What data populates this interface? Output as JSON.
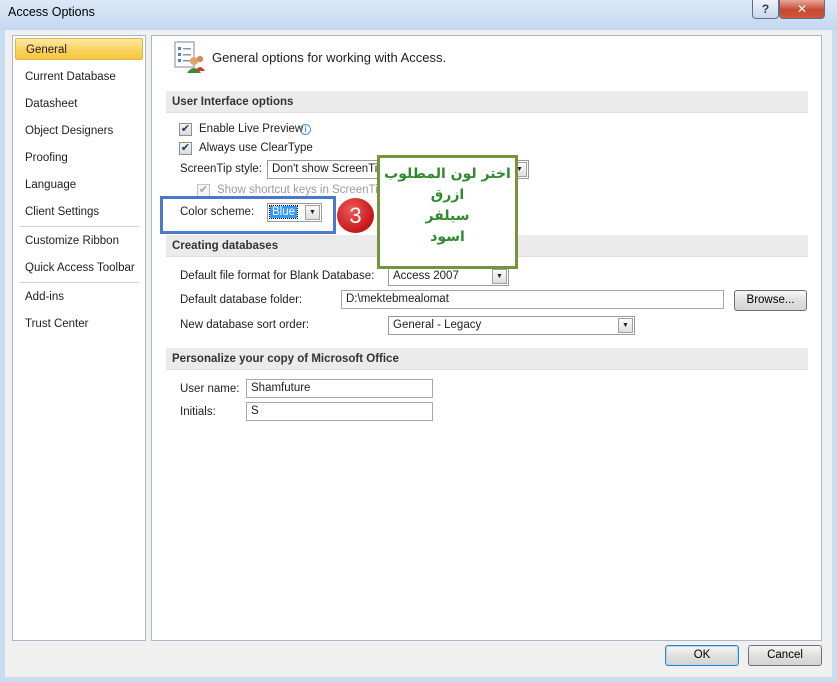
{
  "window": {
    "title": "Access Options",
    "help_label": "?",
    "close_label": "✕"
  },
  "nav": {
    "items": [
      {
        "label": "General",
        "selected": true
      },
      {
        "label": "Current Database"
      },
      {
        "label": "Datasheet"
      },
      {
        "label": "Object Designers"
      },
      {
        "label": "Proofing"
      },
      {
        "label": "Language"
      },
      {
        "label": "Client Settings"
      },
      {
        "label": "Customize Ribbon"
      },
      {
        "label": "Quick Access Toolbar"
      },
      {
        "label": "Add-ins"
      },
      {
        "label": "Trust Center"
      }
    ]
  },
  "header": {
    "text": "General options for working with Access."
  },
  "ui_options": {
    "title": "User Interface options",
    "live_preview": {
      "label": "Enable Live Preview",
      "checked": true
    },
    "cleartype": {
      "label": "Always use ClearType",
      "checked": true
    },
    "screentip": {
      "label": "ScreenTip style:",
      "value": "Don't show ScreenTips"
    },
    "shortcut_keys": {
      "label": "Show shortcut keys in ScreenTips",
      "checked": true,
      "enabled": false
    },
    "color_scheme": {
      "label": "Color scheme:",
      "value": "Blue"
    }
  },
  "creating": {
    "title": "Creating databases",
    "file_format": {
      "label": "Default file format for Blank Database:",
      "value": "Access 2007"
    },
    "folder": {
      "label": "Default database folder:",
      "value": "D:\\mektebmealomat",
      "browse_label": "Browse..."
    },
    "sort_order": {
      "label": "New database sort order:",
      "value": "General - Legacy"
    }
  },
  "personalize": {
    "title": "Personalize your copy of Microsoft Office",
    "user_name": {
      "label": "User name:",
      "value": "Shamfuture"
    },
    "initials": {
      "label": "Initials:",
      "value": "S"
    }
  },
  "annotation": {
    "step": "3",
    "lines": [
      "اختر لون المطلوب",
      "ازرق",
      "سيلفر",
      "اسود"
    ]
  },
  "footer": {
    "ok_label": "OK",
    "cancel_label": "Cancel"
  },
  "colors": {
    "accent_selected": "#fbd25e",
    "highlight_border": "#4a79c9",
    "callout_border": "#77933c",
    "callout_text": "#2d8a2d",
    "badge": "#d42020"
  }
}
